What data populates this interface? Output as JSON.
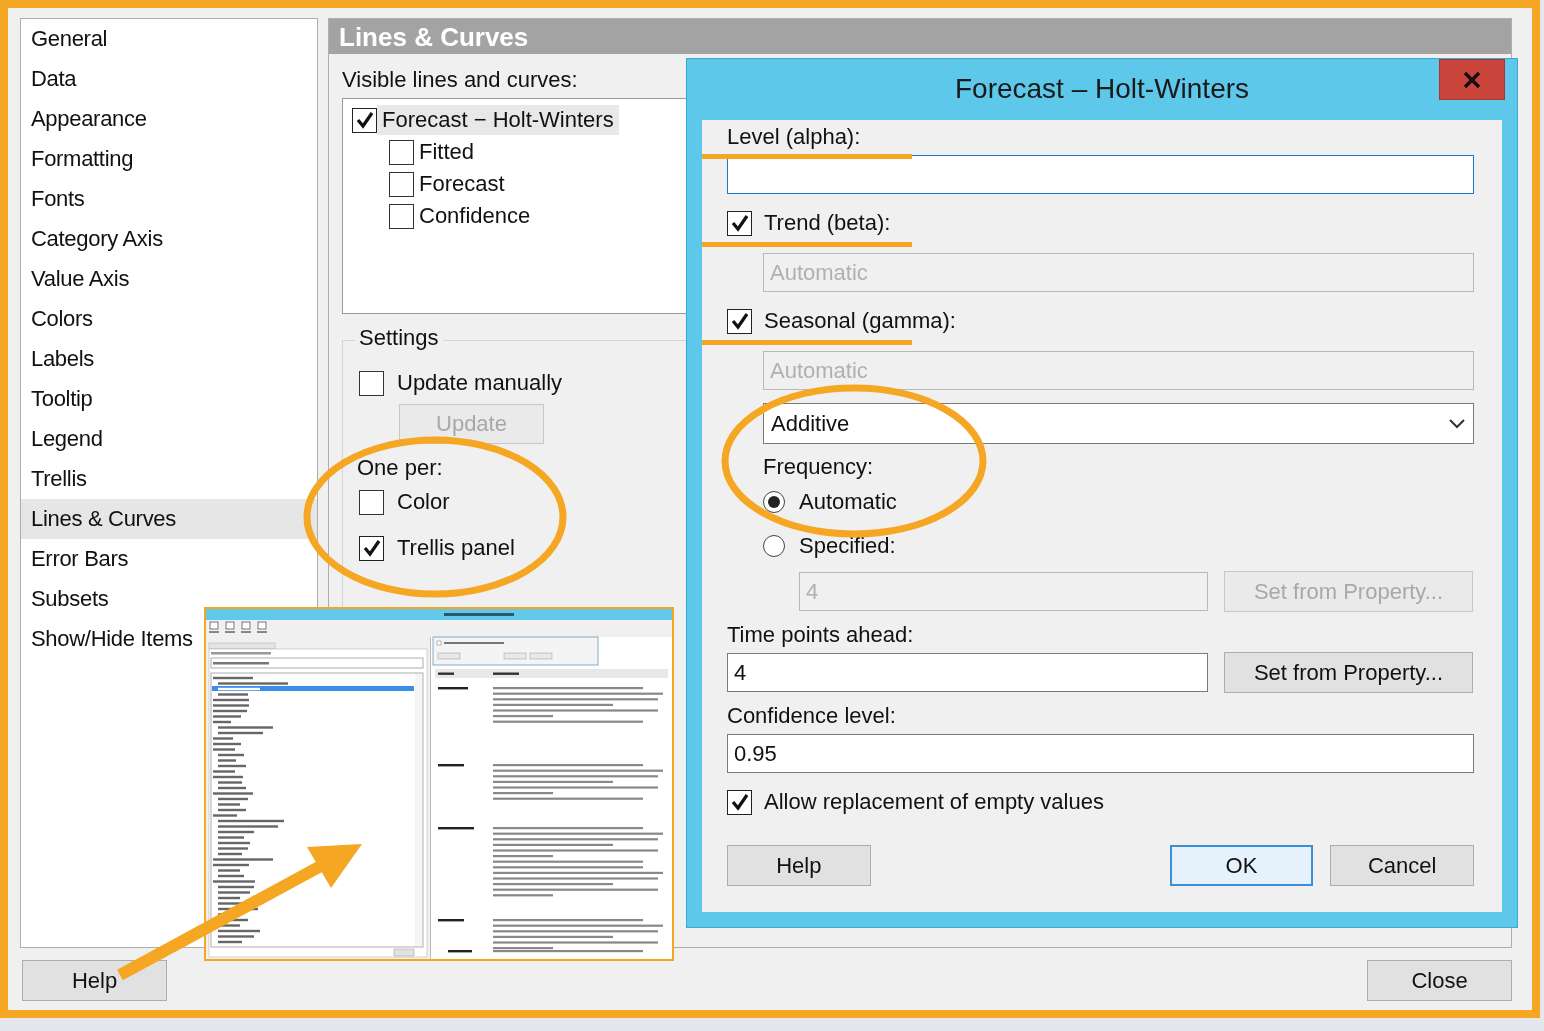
{
  "sidebar": {
    "items": [
      {
        "label": "General",
        "selected": false
      },
      {
        "label": "Data",
        "selected": false
      },
      {
        "label": "Appearance",
        "selected": false
      },
      {
        "label": "Formatting",
        "selected": false
      },
      {
        "label": "Fonts",
        "selected": false
      },
      {
        "label": "Category Axis",
        "selected": false
      },
      {
        "label": "Value Axis",
        "selected": false
      },
      {
        "label": "Colors",
        "selected": false
      },
      {
        "label": "Labels",
        "selected": false
      },
      {
        "label": "Tooltip",
        "selected": false
      },
      {
        "label": "Legend",
        "selected": false
      },
      {
        "label": "Trellis",
        "selected": false
      },
      {
        "label": "Lines & Curves",
        "selected": true
      },
      {
        "label": "Error Bars",
        "selected": false
      },
      {
        "label": "Subsets",
        "selected": false
      },
      {
        "label": "Show/Hide Items",
        "selected": false
      }
    ]
  },
  "panel": {
    "title": "Lines & Curves",
    "list_label": "Visible lines and curves:",
    "curves": [
      {
        "label": "Forecast − Holt-Winters",
        "checked": true,
        "selected": true,
        "children": [
          {
            "label": "Fitted",
            "checked": false,
            "selected": false
          },
          {
            "label": "Forecast",
            "checked": false,
            "selected": false
          },
          {
            "label": "Confidence",
            "checked": false,
            "selected": false
          }
        ]
      }
    ],
    "settings": {
      "title": "Settings",
      "update_manually": {
        "label": "Update manually",
        "checked": false
      },
      "update_button": {
        "label": "Update",
        "disabled": true
      },
      "one_per": {
        "label": "One per:",
        "circled": true,
        "options": [
          {
            "label": "Color",
            "checked": false
          },
          {
            "label": "Trellis panel",
            "checked": true
          }
        ]
      }
    }
  },
  "buttons": {
    "help": "Help",
    "close": "Close"
  },
  "dialog": {
    "title": "Forecast – Holt-Winters",
    "fields": [
      {
        "kind": "text",
        "label": "Level (alpha):",
        "focused": true,
        "underlined": true
      },
      {
        "kind": "check_text",
        "label": "Trend (beta):",
        "checked": true,
        "underlined": true,
        "value": "Automatic",
        "disabled": true
      },
      {
        "kind": "check_text",
        "label": "Seasonal (gamma):",
        "checked": true,
        "underlined": true,
        "value": "Automatic",
        "disabled": true
      },
      {
        "kind": "select",
        "value": "Additive",
        "circled": true
      },
      {
        "kind": "radio_group",
        "label": "Frequency:",
        "options": [
          {
            "label": "Automatic",
            "selected": true
          },
          {
            "label": "Specified:",
            "selected": false
          }
        ],
        "specified": {
          "value": "4",
          "button": "Set from Property...",
          "disabled": true
        }
      },
      {
        "kind": "text_button",
        "label": "Time points ahead:",
        "value": "4",
        "button": "Set from Property...",
        "disabled": false
      },
      {
        "kind": "text",
        "label": "Confidence level:",
        "value": "0.95",
        "focused": false
      },
      {
        "kind": "checkbox",
        "label": "Allow replacement of empty values",
        "checked": true
      }
    ],
    "buttons": [
      {
        "label": "Help",
        "default": false
      },
      {
        "label": "OK",
        "default": true
      },
      {
        "label": "Cancel",
        "default": false
      }
    ]
  },
  "help_preview": {
    "kind": "thumbnail",
    "arrow": true
  }
}
